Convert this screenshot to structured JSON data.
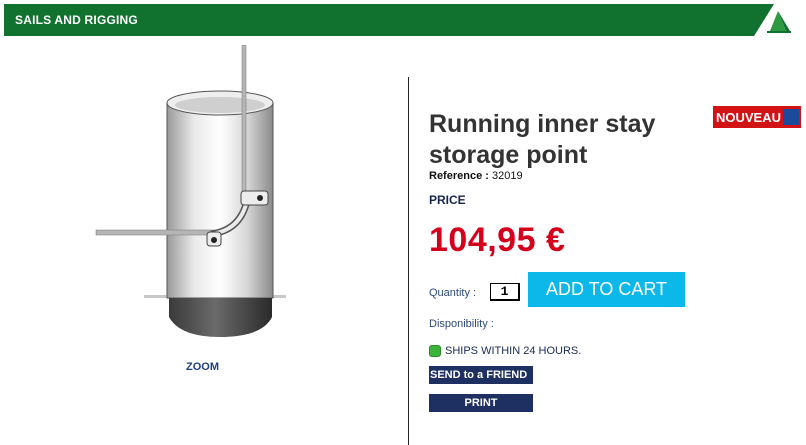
{
  "header": {
    "title": "SAILS AND RIGGING",
    "icon": "sail-icon",
    "bg_color": "#11722f"
  },
  "product": {
    "image": "stay-storage-fitting-image",
    "zoom_label": "ZOOM",
    "title": "Running inner stay storage point",
    "badge": {
      "text": "NOUVEAU",
      "icon": "new-badge-icon"
    },
    "reference_label": "Reference :",
    "reference_value": "32019",
    "price_label": "PRICE",
    "price": "104,95 €",
    "price_color": "#d5001c",
    "quantity_label": "Quantity :",
    "quantity_value": "1",
    "add_to_cart_label": "ADD TO CART",
    "add_to_cart_color": "#0cb7e9",
    "availability_label": "Disponibility :",
    "availability_status": "SHIPS WITHIN 24 HOURS.",
    "availability_color": "#3cb33a",
    "send_friend_label": "SEND to a FRIEND",
    "print_label": "PRINT"
  }
}
